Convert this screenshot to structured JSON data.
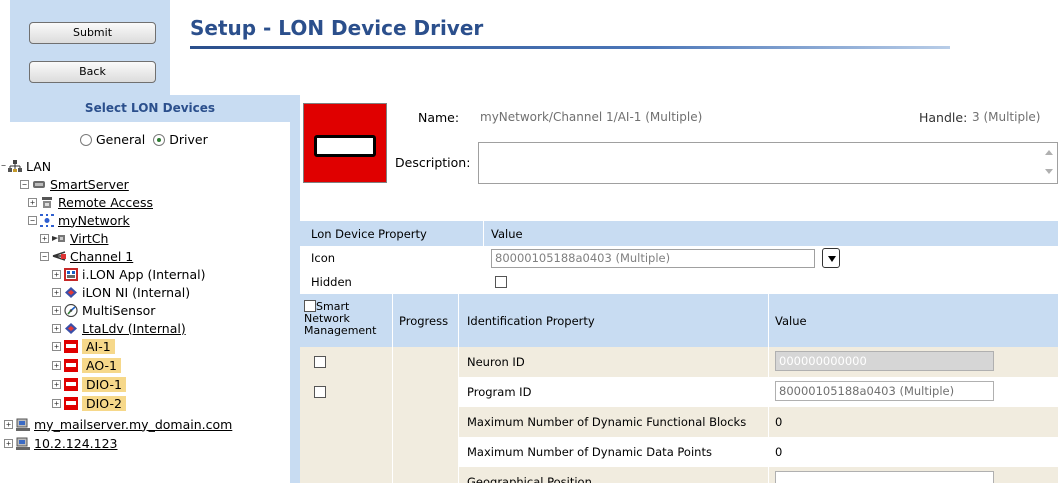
{
  "header": {
    "submit_label": "Submit",
    "back_label": "Back",
    "title": "Setup - LON Device Driver"
  },
  "left": {
    "select_title": "Select LON Devices",
    "radio_general": "General",
    "radio_driver": "Driver",
    "selected_mode": "Driver",
    "tree": {
      "lan": "LAN",
      "smartserver": "SmartServer",
      "remote_access": "Remote Access",
      "mynetwork": "myNetwork",
      "virtch": "VirtCh",
      "channel1": "Channel 1",
      "ilon_app": "i.LON App (Internal)",
      "ilon_ni": "iLON NI (Internal)",
      "multisensor": "MultiSensor",
      "ltaldv": "LtaLdv (Internal)",
      "ai1": "AI-1",
      "ao1": "AO-1",
      "dio1": "DIO-1",
      "dio2": "DIO-2",
      "mailserver": "my_mailserver.my_domain.com",
      "ip": "10.2.124.123"
    }
  },
  "device": {
    "name_label": "Name:",
    "name_value": "myNetwork/Channel 1/AI-1 (Multiple)",
    "handle_label": "Handle:",
    "handle_value": "3 (Multiple)",
    "description_label": "Description:",
    "description_value": ""
  },
  "props": {
    "col_property": "Lon Device Property",
    "col_value": "Value",
    "icon_label": "Icon",
    "icon_value": "80000105188a0403 (Multiple)",
    "hidden_label": "Hidden",
    "hidden_checked": false
  },
  "ident": {
    "col_smart": "Smart Network Management",
    "col_progress": "Progress",
    "col_property": "Identification Property",
    "col_value": "Value",
    "rows": [
      {
        "label": "Neuron ID",
        "value": "000000000000",
        "has_check": true,
        "input": "disabled"
      },
      {
        "label": "Program ID",
        "value": "80000105188a0403 (Multiple)",
        "has_check": true,
        "input": "text"
      },
      {
        "label": "Maximum Number of Dynamic Functional Blocks",
        "value": "0",
        "has_check": false,
        "input": "none"
      },
      {
        "label": "Maximum Number of Dynamic Data Points",
        "value": "0",
        "has_check": false,
        "input": "none"
      },
      {
        "label": "Geographical Position",
        "value": "",
        "has_check": false,
        "input": "text"
      }
    ]
  }
}
